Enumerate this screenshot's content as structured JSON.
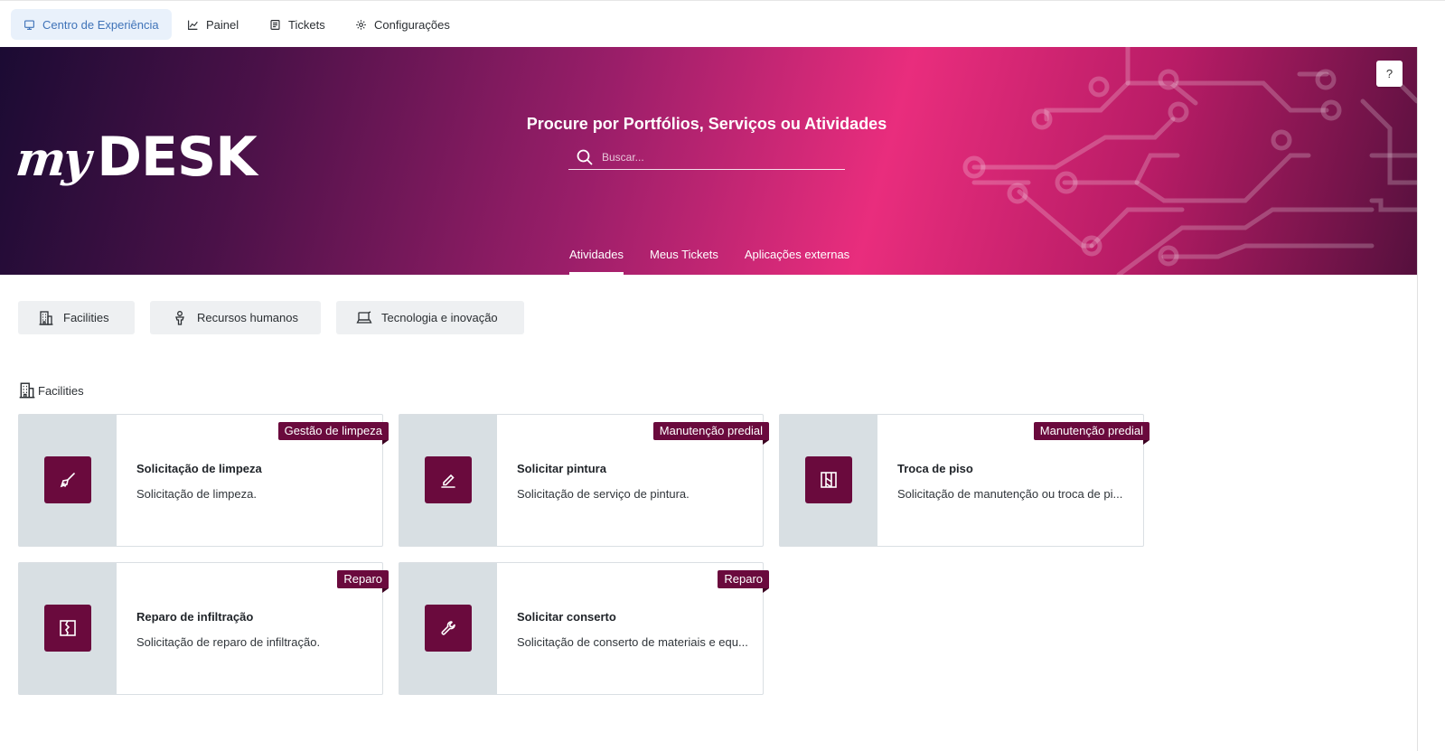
{
  "nav": {
    "items": [
      {
        "label": "Centro de Experiência",
        "icon": "monitor-icon",
        "active": true
      },
      {
        "label": "Painel",
        "icon": "line-chart-icon"
      },
      {
        "label": "Tickets",
        "icon": "ticket-list-icon"
      },
      {
        "label": "Configurações",
        "icon": "gear-icon"
      }
    ]
  },
  "hero": {
    "logo_my": "my",
    "logo_desk": "DESK",
    "title": "Procure por Portfólios, Serviços ou Atividades",
    "search_placeholder": "Buscar...",
    "tabs": [
      {
        "label": "Atividades",
        "active": true
      },
      {
        "label": "Meus Tickets"
      },
      {
        "label": "Aplicações externas"
      }
    ],
    "help_label": "?"
  },
  "categories": [
    {
      "label": "Facilities",
      "icon": "building-icon"
    },
    {
      "label": "Recursos humanos",
      "icon": "person-icon"
    },
    {
      "label": "Tecnologia e inovação",
      "icon": "laptop-icon"
    }
  ],
  "section": {
    "title": "Facilities",
    "icon": "building-icon"
  },
  "cards": [
    {
      "title": "Solicitação de limpeza",
      "description": "Solicitação de limpeza.",
      "tag": "Gestão de limpeza",
      "icon": "broom-icon"
    },
    {
      "title": "Solicitar pintura",
      "description": "Solicitação de serviço de pintura.",
      "tag": "Manutenção predial",
      "icon": "paint-icon"
    },
    {
      "title": "Troca de piso",
      "description": "Solicitação de manutenção ou troca de pi...",
      "tag": "Manutenção predial",
      "icon": "floor-icon"
    },
    {
      "title": "Reparo de infiltração",
      "description": "Solicitação de reparo de infiltração.",
      "tag": "Reparo",
      "icon": "wall-crack-icon"
    },
    {
      "title": "Solicitar conserto",
      "description": "Solicitação de conserto de materiais e equ...",
      "tag": "Reparo",
      "icon": "wrench-icon"
    }
  ],
  "colors": {
    "accent": "#6a0a3d",
    "hero_pink": "#e92d7d",
    "hero_dark": "#1b0b33",
    "active_nav_bg": "#e9f1fb",
    "active_nav_text": "#3f73b8",
    "card_side": "#d8dfe3"
  }
}
